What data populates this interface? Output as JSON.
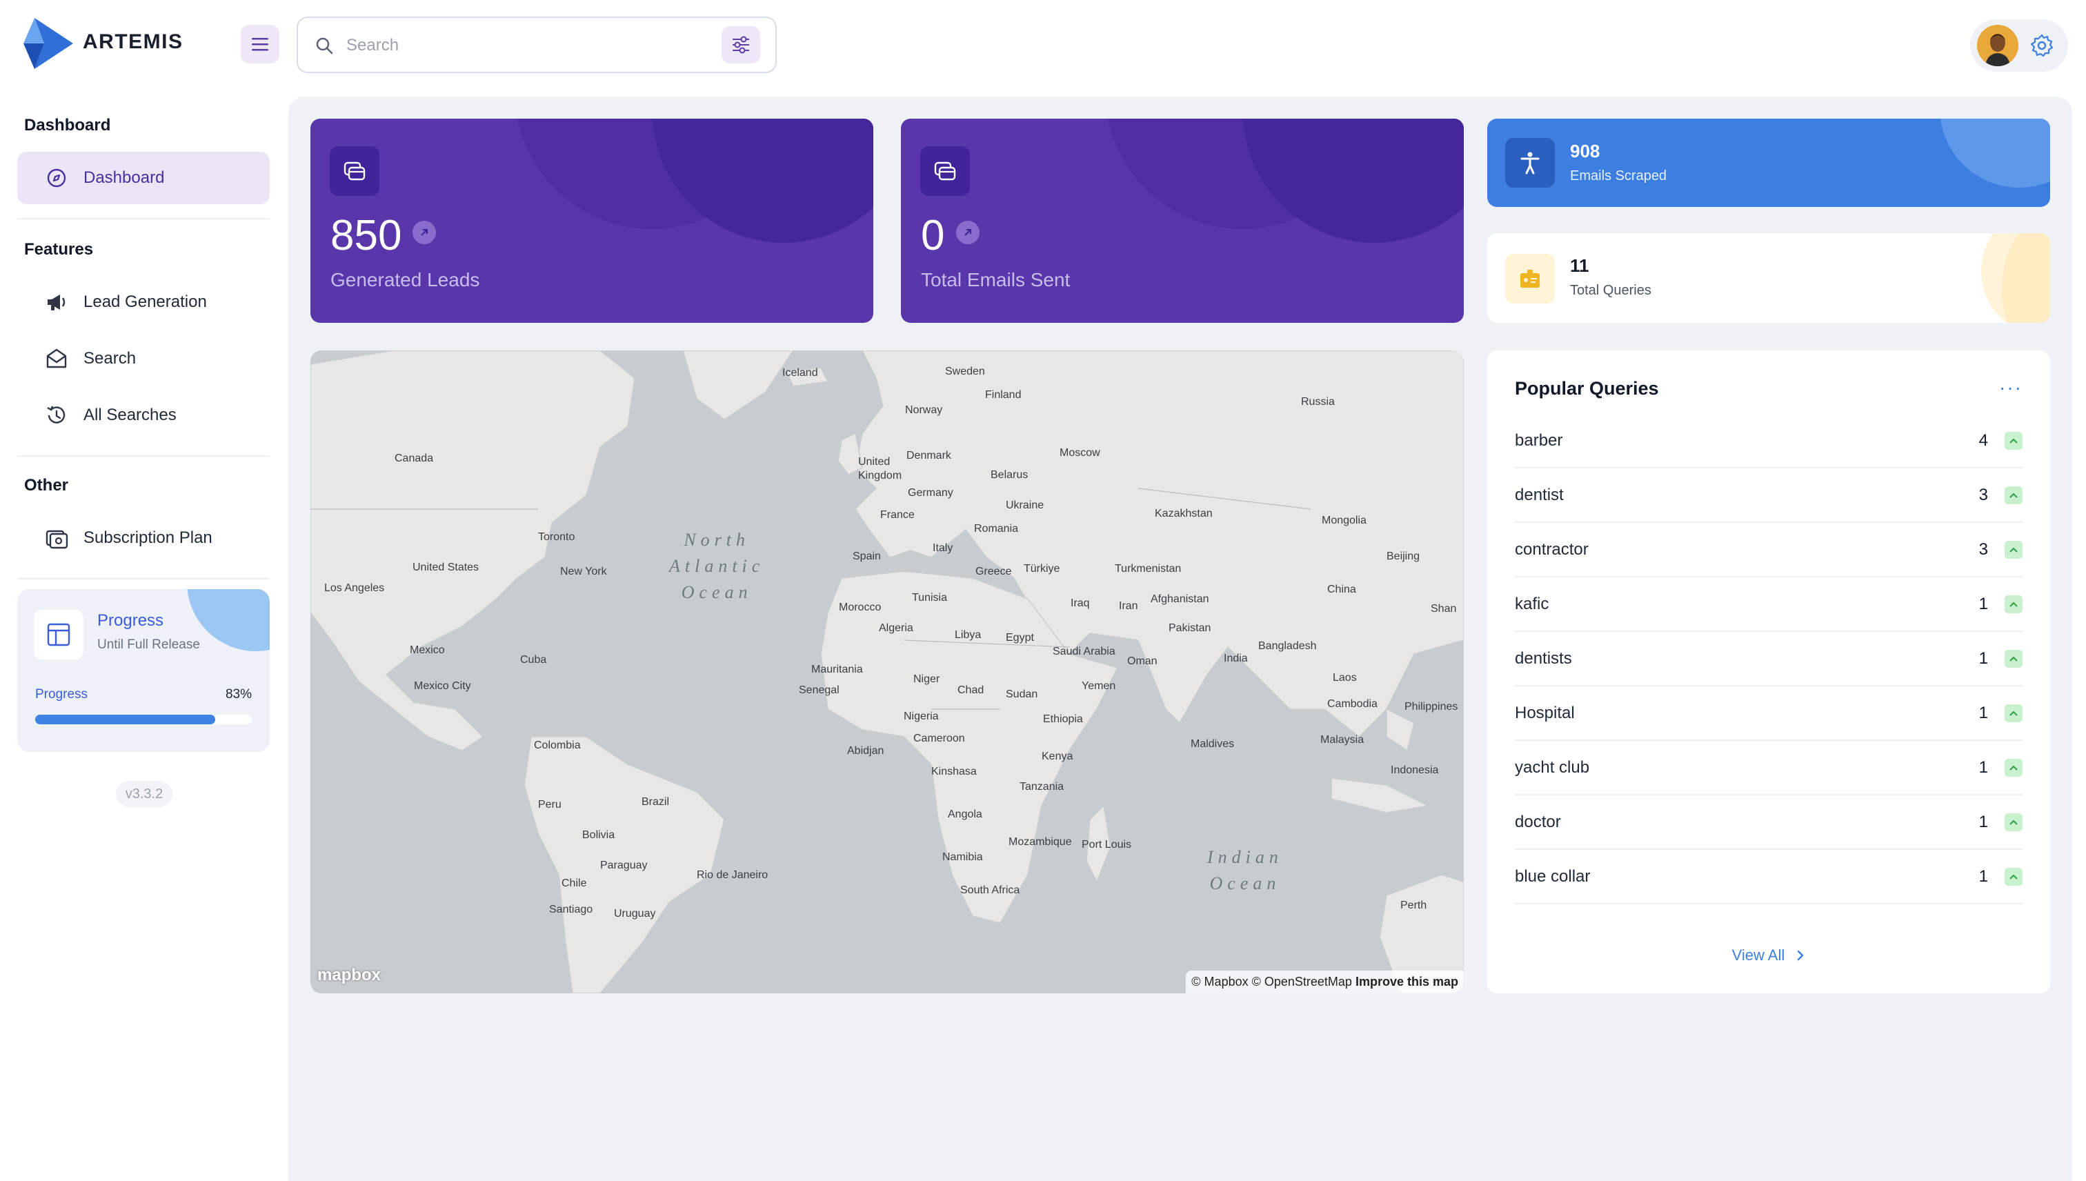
{
  "app": {
    "brand": "ARTEMIS",
    "version": "v3.3.2"
  },
  "header": {
    "search_placeholder": "Search"
  },
  "sidebar": {
    "sections": [
      {
        "title": "Dashboard"
      },
      {
        "title": "Features"
      },
      {
        "title": "Other"
      }
    ],
    "items": [
      {
        "label": "Dashboard",
        "icon": "dashboard-icon",
        "active": true
      },
      {
        "label": "Lead Generation",
        "icon": "megaphone-icon"
      },
      {
        "label": "Search",
        "icon": "mail-icon"
      },
      {
        "label": "All Searches",
        "icon": "history-icon"
      },
      {
        "label": "Subscription Plan",
        "icon": "subscription-icon"
      }
    ],
    "progress": {
      "title": "Progress",
      "subtitle": "Until Full Release",
      "label": "Progress",
      "value_text": "83%",
      "value": 0.83
    }
  },
  "stats": {
    "leads": {
      "value": "850",
      "label": "Generated Leads"
    },
    "emails_sent": {
      "value": "0",
      "label": "Total Emails Sent"
    },
    "emails_scraped": {
      "value": "908",
      "label": "Emails Scraped"
    },
    "queries": {
      "value": "11",
      "label": "Total Queries"
    }
  },
  "map": {
    "oceans": [
      "North\nAtlantic\nOcean",
      "Indian\nOcean"
    ],
    "labels": [
      "Iceland",
      "Sweden",
      "Finland",
      "Norway",
      "Russia",
      "Canada",
      "Denmark",
      "United\nKingdom",
      "Moscow",
      "Belarus",
      "Germany",
      "Ukraine",
      "Kazakhstan",
      "Mongolia",
      "France",
      "Romania",
      "Toronto",
      "United States",
      "New York",
      "Spain",
      "Italy",
      "Greece",
      "Türkiye",
      "Turkmenistan",
      "Beijing",
      "Los Angeles",
      "Tunisia",
      "Afghanistan",
      "China",
      "Morocco",
      "Iraq",
      "Iran",
      "Shan",
      "Algeria",
      "Libya",
      "Egypt",
      "Pakistan",
      "Mexico",
      "Cuba",
      "Saudi Arabia",
      "Bangladesh",
      "Oman",
      "India",
      "Mexico City",
      "Mauritania",
      "Senegal",
      "Niger",
      "Chad",
      "Sudan",
      "Yemen",
      "Laos",
      "Cambodia",
      "Philippines",
      "Nigeria",
      "Ethiopia",
      "Colombia",
      "Abidjan",
      "Cameroon",
      "Maldives",
      "Malaysia",
      "Kenya",
      "Kinshasa",
      "Indonesia",
      "Tanzania",
      "Peru",
      "Brazil",
      "Angola",
      "Bolivia",
      "Mozambique",
      "Port Louis",
      "Namibia",
      "Paraguay",
      "Rio de Janeiro",
      "Chile",
      "South Africa",
      "Perth",
      "Santiago",
      "Uruguay"
    ],
    "logo": "mapbox",
    "attribution": "© Mapbox © OpenStreetMap",
    "improve": "Improve this map"
  },
  "popular_queries": {
    "title": "Popular Queries",
    "more": "···",
    "view_all": "View All",
    "items": [
      {
        "name": "barber",
        "count": "4"
      },
      {
        "name": "dentist",
        "count": "3"
      },
      {
        "name": "contractor",
        "count": "3"
      },
      {
        "name": "kafic",
        "count": "1"
      },
      {
        "name": "dentists",
        "count": "1"
      },
      {
        "name": "Hospital",
        "count": "1"
      },
      {
        "name": "yacht club",
        "count": "1"
      },
      {
        "name": "doctor",
        "count": "1"
      },
      {
        "name": "blue collar",
        "count": "1"
      }
    ]
  },
  "colors": {
    "purple": "#5a36ab",
    "blue": "#3d7fe0",
    "bg": "#eef1f6"
  }
}
